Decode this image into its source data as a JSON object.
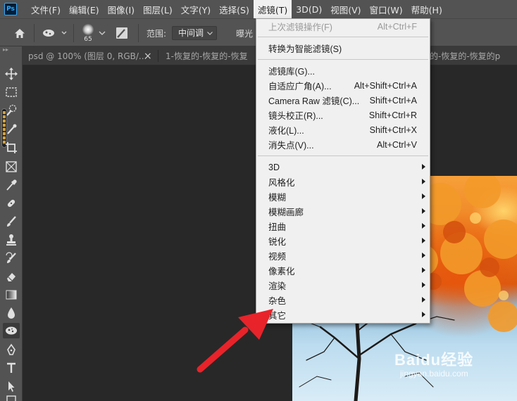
{
  "app": {
    "logo": "Ps"
  },
  "menubar": {
    "items": [
      "文件(F)",
      "编辑(E)",
      "图像(I)",
      "图层(L)",
      "文字(Y)",
      "选择(S)",
      "滤镜(T)",
      "3D(D)",
      "视图(V)",
      "窗口(W)",
      "帮助(H)"
    ]
  },
  "options": {
    "brush_size": "65",
    "range_label": "范围:",
    "range_value": "中间调",
    "exposure_label": "曝光"
  },
  "tabs": [
    {
      "label": "psd @ 100% (图层 0, RGB/...",
      "close": "×"
    },
    {
      "label": "1-恢复的-恢复的-恢复",
      "close": ""
    },
    {
      "label": "的-恢复的-恢复的p",
      "close": ""
    }
  ],
  "filter_menu": {
    "items": [
      {
        "label": "上次滤镜操作(F)",
        "shortcut": "Alt+Ctrl+F",
        "disabled": true
      },
      {
        "label": "转换为智能滤镜(S)",
        "shortcut": ""
      },
      {
        "label": "滤镜库(G)...",
        "shortcut": ""
      },
      {
        "label": "自适应广角(A)...",
        "shortcut": "Alt+Shift+Ctrl+A"
      },
      {
        "label": "Camera Raw 滤镜(C)...",
        "shortcut": "Shift+Ctrl+A"
      },
      {
        "label": "镜头校正(R)...",
        "shortcut": "Shift+Ctrl+R"
      },
      {
        "label": "液化(L)...",
        "shortcut": "Shift+Ctrl+X"
      },
      {
        "label": "消失点(V)...",
        "shortcut": "Alt+Ctrl+V"
      },
      {
        "label": "3D",
        "submenu": true
      },
      {
        "label": "风格化",
        "submenu": true
      },
      {
        "label": "模糊",
        "submenu": true
      },
      {
        "label": "模糊画廊",
        "submenu": true
      },
      {
        "label": "扭曲",
        "submenu": true
      },
      {
        "label": "锐化",
        "submenu": true
      },
      {
        "label": "视频",
        "submenu": true
      },
      {
        "label": "像素化",
        "submenu": true
      },
      {
        "label": "渲染",
        "submenu": true
      },
      {
        "label": "杂色",
        "submenu": true
      },
      {
        "label": "其它",
        "submenu": true
      }
    ]
  },
  "watermark": {
    "brand": "Baidu经验",
    "url": "jingyan.baidu.com"
  },
  "colors": {
    "menubar": "#535353",
    "canvas": "#282828",
    "menu_bg": "#f0f0f0",
    "arrow": "#e8232a"
  }
}
